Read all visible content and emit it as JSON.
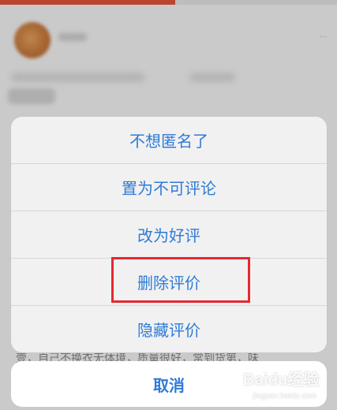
{
  "action_sheet": {
    "items": [
      {
        "label": "不想匿名了"
      },
      {
        "label": "置为不可评论"
      },
      {
        "label": "改为好评"
      },
      {
        "label": "删除评价"
      },
      {
        "label": "隐藏评价"
      }
    ],
    "highlighted_item_index": 3
  },
  "cancel_button": {
    "label": "取消"
  },
  "background_snippet": "壹，自己不换衣无体境，质量很好，常到货第，味",
  "watermark": {
    "brand": "Baidu经验",
    "url": "jingyan.baidu.com"
  },
  "colors": {
    "action_text": "#2f7bd6",
    "highlight_border": "#e62831",
    "tab_accent": "#e4573d"
  }
}
